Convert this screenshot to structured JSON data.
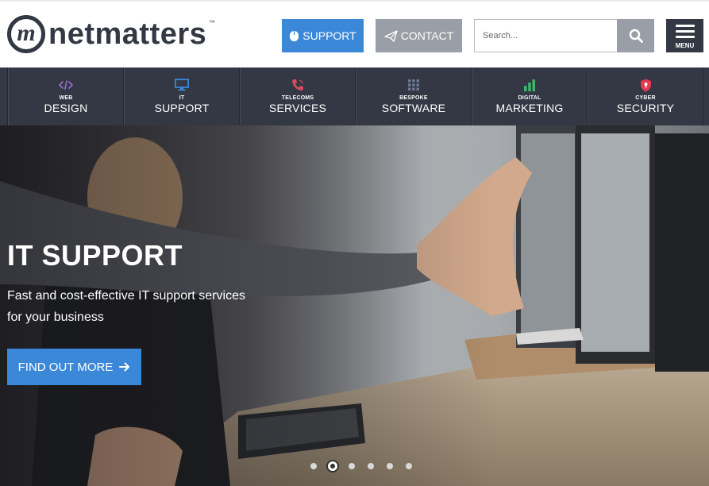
{
  "brand": {
    "name": "netmatters",
    "mark": "m",
    "tm": "™"
  },
  "header": {
    "support_label": "SUPPORT",
    "contact_label": "CONTACT",
    "search_placeholder": "Search...",
    "menu_label": "MENU"
  },
  "services": [
    {
      "small": "WEB",
      "big": "DESIGN",
      "icon": "code-icon",
      "color": "#9b6fd0"
    },
    {
      "small": "IT",
      "big": "SUPPORT",
      "icon": "monitor-icon",
      "color": "#3b88d9"
    },
    {
      "small": "TELECOMS",
      "big": "SERVICES",
      "icon": "phone-icon",
      "color": "#d64a5a"
    },
    {
      "small": "BESPOKE",
      "big": "SOFTWARE",
      "icon": "grid-icon",
      "color": "#6f7a96"
    },
    {
      "small": "DIGITAL",
      "big": "MARKETING",
      "icon": "bar-chart-icon",
      "color": "#3fb56a"
    },
    {
      "small": "CYBER",
      "big": "SECURITY",
      "icon": "shield-icon",
      "color": "#e03c4e"
    }
  ],
  "hero": {
    "title": "IT SUPPORT",
    "subtitle": "Fast and cost-effective IT support services for your business",
    "cta_label": "FIND OUT MORE",
    "slide_count": 6,
    "active_slide": 2
  },
  "colors": {
    "dark": "#333844",
    "accent": "#3b88d9",
    "grey": "#9a9ea6"
  }
}
